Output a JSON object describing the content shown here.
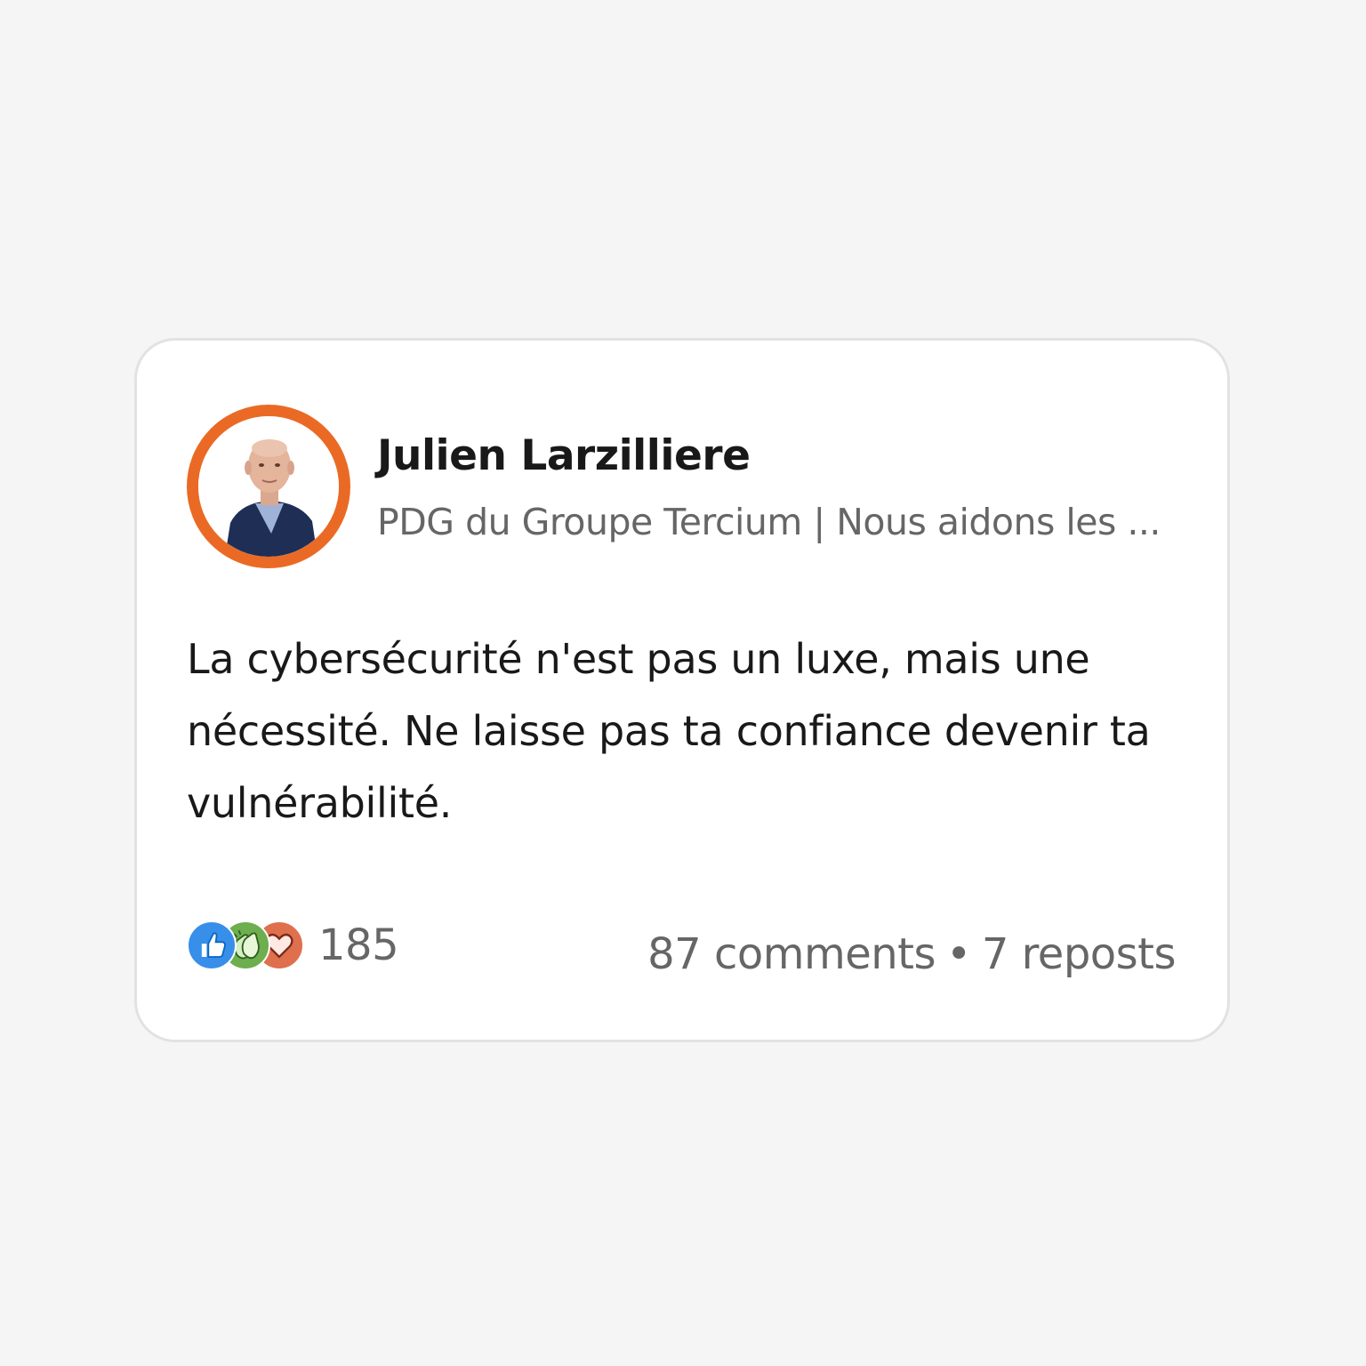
{
  "post": {
    "author": {
      "name": "Julien Larzilliere",
      "headline": "PDG du Groupe Tercium | Nous aidons les ...",
      "avatar_ring_color": "#ea6a25"
    },
    "text": "La cybersécurité n'est pas un luxe, mais une nécessité. Ne laisse pas ta confiance devenir ta vulnérabilité.",
    "reactions": {
      "icons": [
        "like-icon",
        "celebrate-icon",
        "love-icon"
      ],
      "count": "185"
    },
    "comments": "87 comments",
    "separator": "•",
    "reposts": "7 reposts"
  },
  "colors": {
    "like": "#378fe9",
    "celebrate": "#6dae4f",
    "love": "#df704d"
  }
}
